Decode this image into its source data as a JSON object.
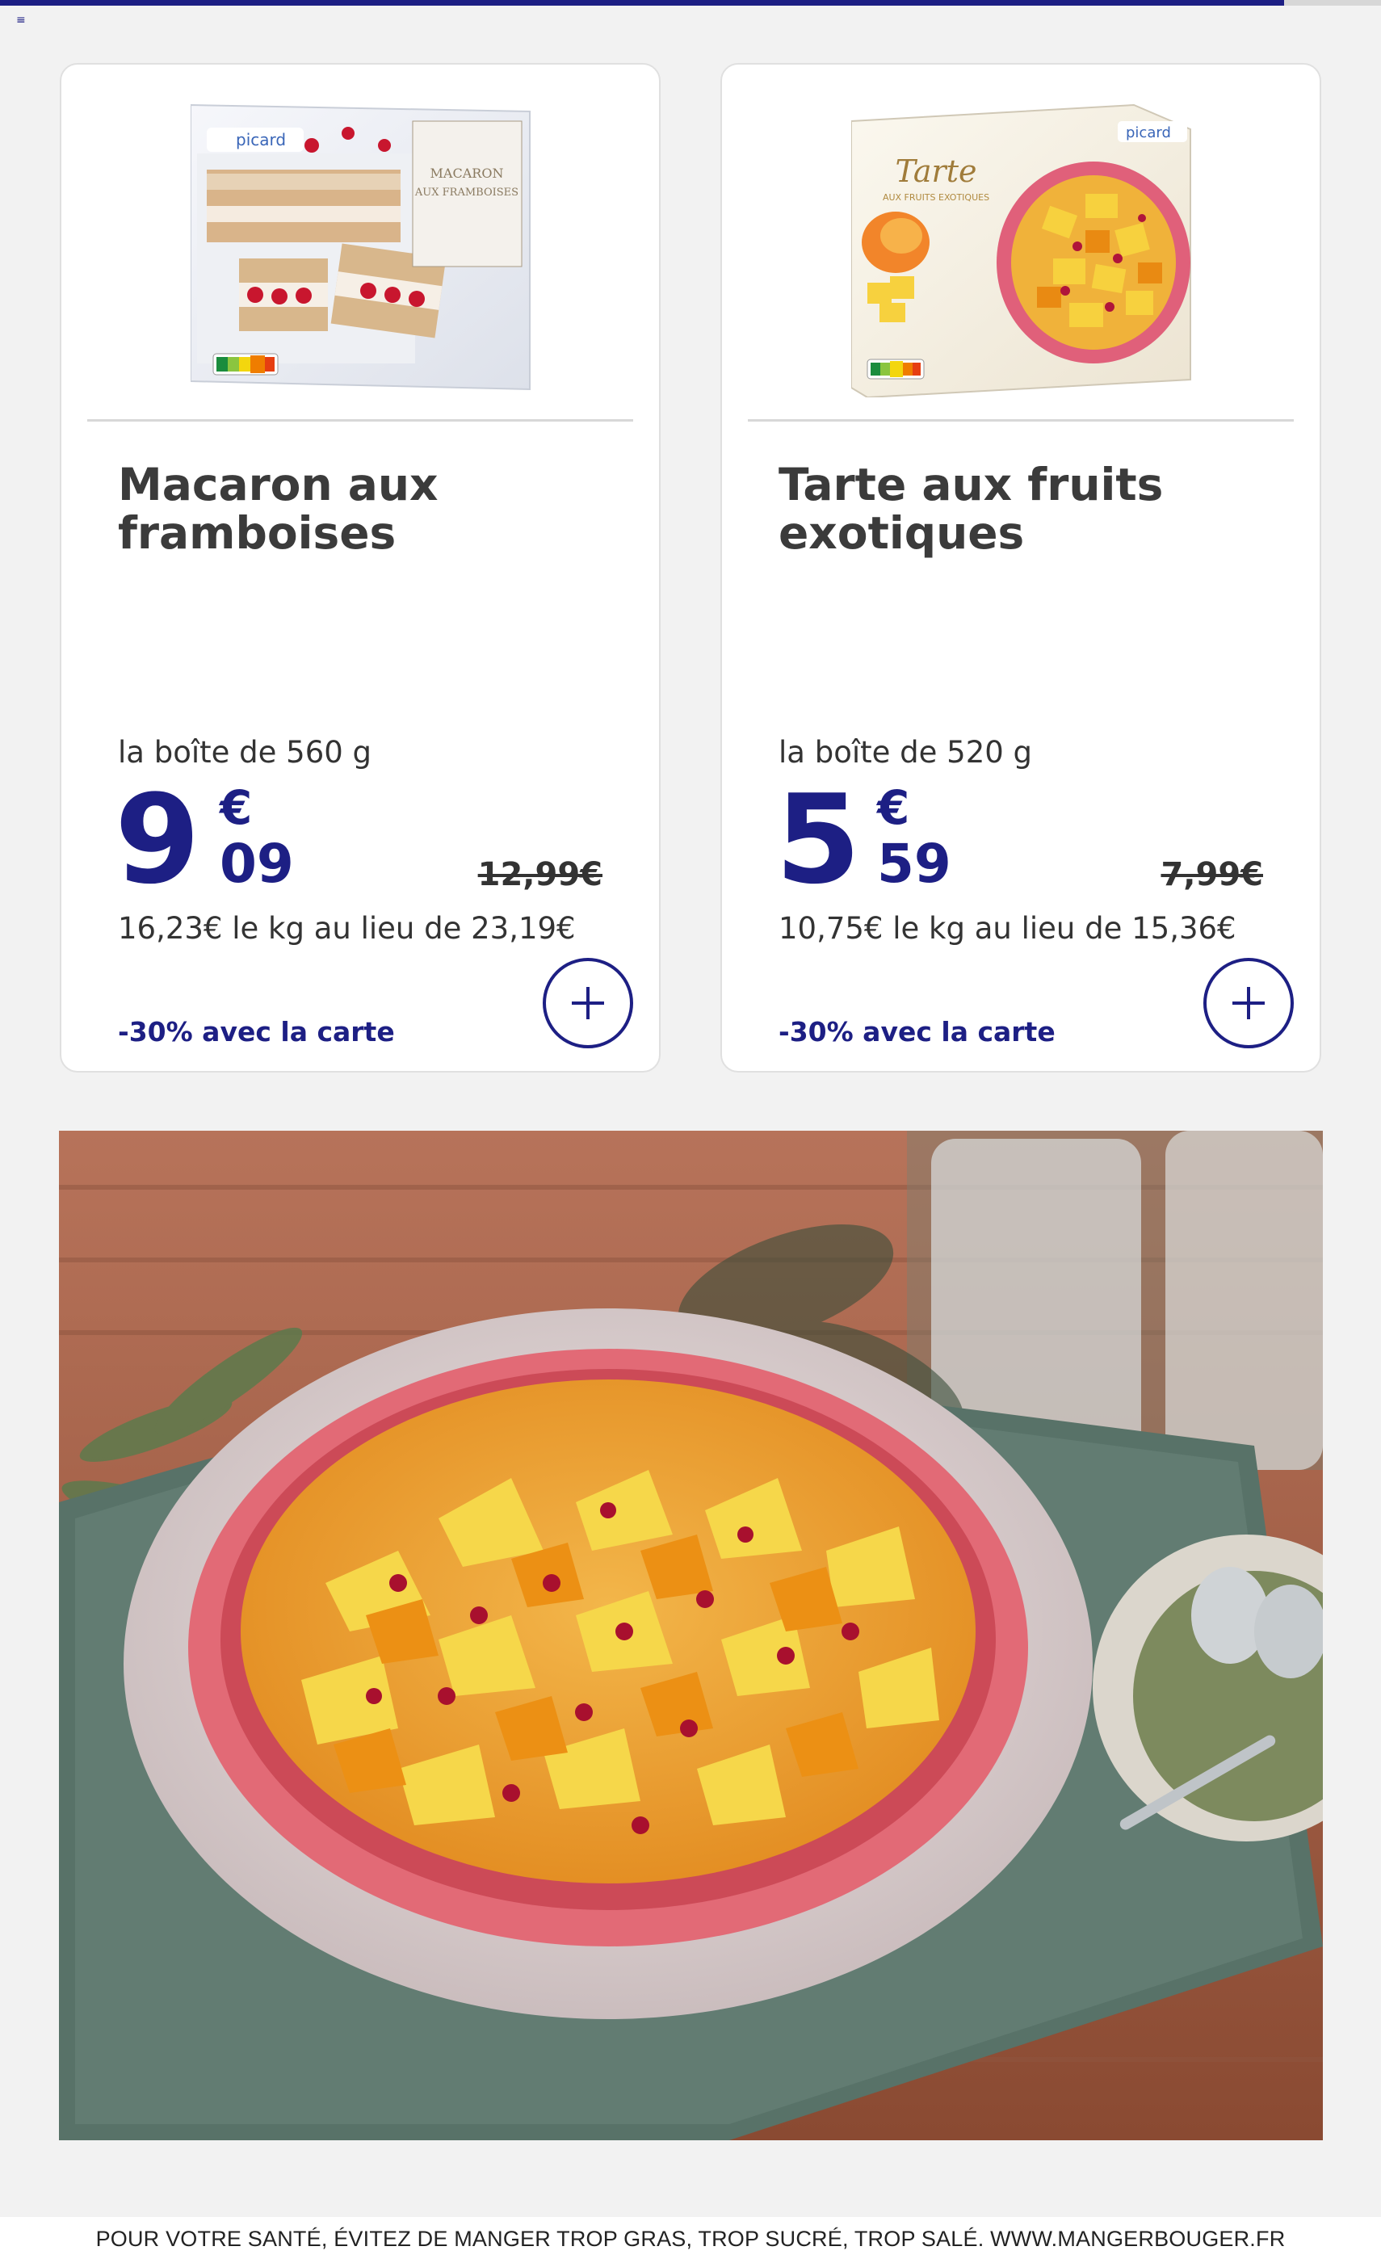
{
  "progress": {
    "fraction": 0.93
  },
  "menu_icon": "menu-icon",
  "brand_colors": {
    "accent": "#1d1f84",
    "background": "#f2f2f2"
  },
  "products": [
    {
      "brand": "picard",
      "package_lines": [
        "MACARON",
        "AUX FRAMBOISES"
      ],
      "title": "Macaron aux framboises",
      "weight": "la boîte de 560 g",
      "price_int": "9",
      "price_euro": "€",
      "price_dec": "09",
      "old_price": "12,99€",
      "per_kg": "16,23€ le kg au lieu de 23,19€",
      "discount": "-30% avec la carte",
      "add_icon": "plus-icon"
    },
    {
      "brand": "picard",
      "package_lines": [
        "Tarte",
        "AUX FRUITS EXOTIQUES"
      ],
      "title": "Tarte aux fruits exotiques",
      "weight": "la boîte de 520 g",
      "price_int": "5",
      "price_euro": "€",
      "price_dec": "59",
      "old_price": "7,99€",
      "per_kg": "10,75€ le kg au lieu de 15,36€",
      "discount": "-30% avec la carte",
      "add_icon": "plus-icon"
    }
  ],
  "footer": {
    "text": "POUR VOTRE SANTÉ, ÉVITEZ DE MANGER TROP GRAS, TROP SUCRÉ, TROP SALÉ. WWW.MANGERBOUGER.FR"
  }
}
